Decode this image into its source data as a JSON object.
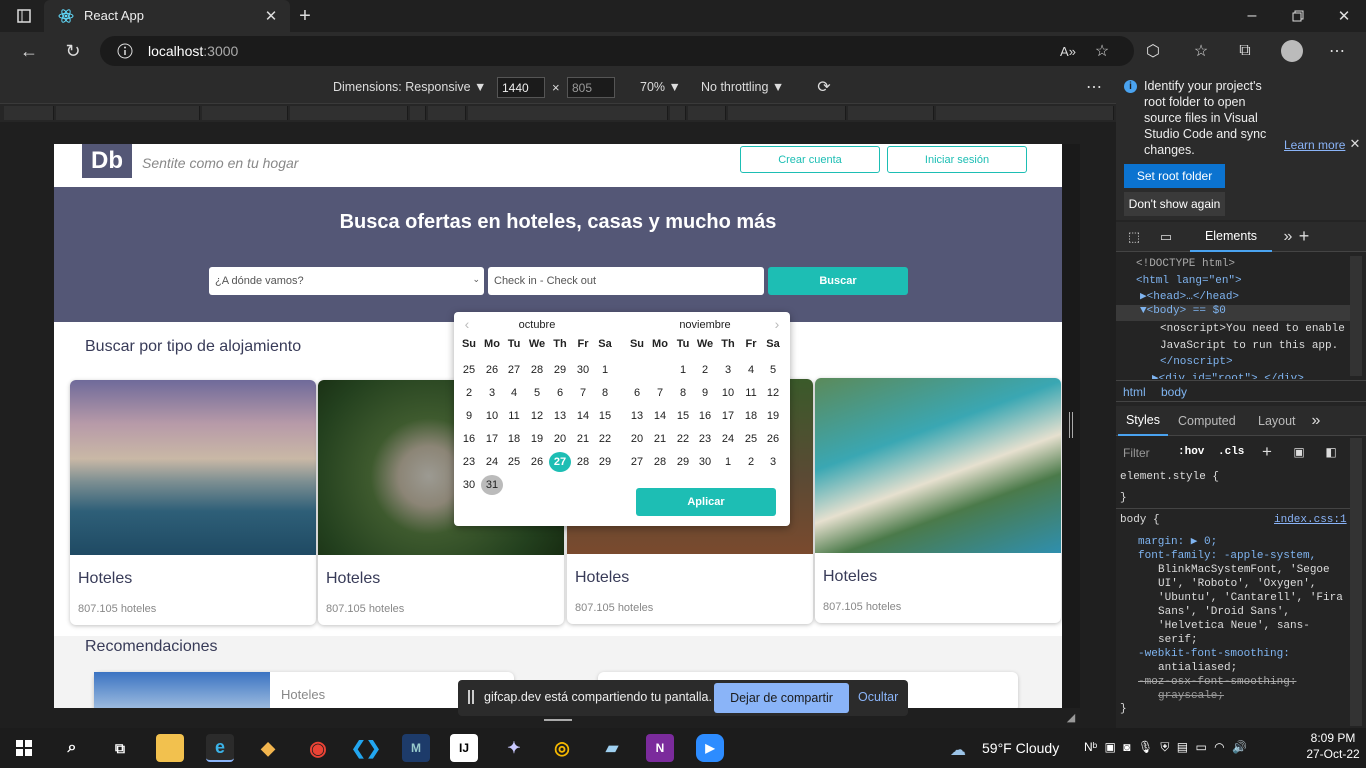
{
  "browser": {
    "tab_title": "React App",
    "url_host": "localhost",
    "url_port": ":3000"
  },
  "emulation": {
    "dimensions_label": "Dimensions: Responsive",
    "width": "1440",
    "height": "805",
    "x": "×",
    "zoom": "70%",
    "throttling": "No throttling"
  },
  "site": {
    "logo": "Db",
    "tagline": "Sentite como en tu hogar",
    "create_account": "Crear cuenta",
    "login": "Iniciar sesión",
    "hero_title": "Busca ofertas en hoteles, casas y mucho más",
    "destination_placeholder": "¿A dónde vamos?",
    "dates_placeholder": "Check in - Check out",
    "search_button": "Buscar",
    "section_title": "Buscar por tipo de alojamiento",
    "cards": [
      {
        "title": "Hoteles",
        "count": "807.105 hoteles"
      },
      {
        "title": "Hoteles",
        "count": "807.105 hoteles"
      },
      {
        "title": "Hoteles",
        "count": "807.105 hoteles"
      },
      {
        "title": "Hoteles",
        "count": "807.105 hoteles"
      }
    ],
    "recommendations_title": "Recomendaciones",
    "rec_card_title": "Hoteles"
  },
  "calendar": {
    "month1": "octubre",
    "month2": "noviembre",
    "weekdays": [
      "Su",
      "Mo",
      "Tu",
      "We",
      "Th",
      "Fr",
      "Sa"
    ],
    "month1_days": [
      [
        "25",
        "26",
        "27",
        "28",
        "29",
        "30",
        "1"
      ],
      [
        "2",
        "3",
        "4",
        "5",
        "6",
        "7",
        "8"
      ],
      [
        "9",
        "10",
        "11",
        "12",
        "13",
        "14",
        "15"
      ],
      [
        "16",
        "17",
        "18",
        "19",
        "20",
        "21",
        "22"
      ],
      [
        "23",
        "24",
        "25",
        "26",
        "27",
        "28",
        "29"
      ],
      [
        "30",
        "31",
        "",
        "",
        "",
        "",
        ""
      ]
    ],
    "month2_days": [
      [
        "",
        "",
        "1",
        "2",
        "3",
        "4",
        "5"
      ],
      [
        "6",
        "7",
        "8",
        "9",
        "10",
        "11",
        "12"
      ],
      [
        "13",
        "14",
        "15",
        "16",
        "17",
        "18",
        "19"
      ],
      [
        "20",
        "21",
        "22",
        "23",
        "24",
        "25",
        "26"
      ],
      [
        "27",
        "28",
        "29",
        "30",
        "1",
        "2",
        "3"
      ]
    ],
    "selected_day": "27",
    "apply_button": "Aplicar"
  },
  "devtools": {
    "info_text": "Identify your project's root folder to open source files in Visual Studio Code and sync changes.",
    "learn_more": "Learn more",
    "set_root": "Set root folder",
    "dont_show": "Don't show again",
    "elements_tab": "Elements",
    "dom_lines": [
      "<!DOCTYPE html>",
      "<html lang=\"en\">",
      "▶<head>…</head>",
      "▼<body> == $0",
      "<noscript>You need to enable",
      "JavaScript to run this app.",
      "</noscript>",
      "▶<div id=\"root\">…</div>"
    ],
    "crumb_html": "html",
    "crumb_body": "body",
    "styles_tab": "Styles",
    "computed_tab": "Computed",
    "layout_tab": "Layout",
    "filter": "Filter",
    "hov": ":hov",
    "cls": ".cls",
    "element_style": "element.style {",
    "close_brace": "}",
    "body_selector": "body {",
    "source_link": "index.css:1",
    "css_lines": [
      "margin: ▶ 0;",
      "font-family: -apple-system,",
      "BlinkMacSystemFont, 'Segoe",
      "UI', 'Roboto', 'Oxygen',",
      "'Ubuntu', 'Cantarell', 'Fira",
      "Sans', 'Droid Sans',",
      "'Helvetica Neue', sans-",
      "serif;",
      "-webkit-font-smoothing:",
      "antialiased;",
      "-moz-osx-font-smoothing:",
      "grayscale;"
    ]
  },
  "share_bar": {
    "text": "gifcap.dev está compartiendo tu pantalla.",
    "stop": "Dejar de compartir",
    "hide": "Ocultar"
  },
  "taskbar": {
    "weather": "59°F  Cloudy",
    "time": "8:09 PM",
    "date": "27-Oct-22"
  },
  "colors": {
    "accent": "#1dbeb4",
    "hero_bg": "#545776",
    "title_text": "#383b58"
  }
}
